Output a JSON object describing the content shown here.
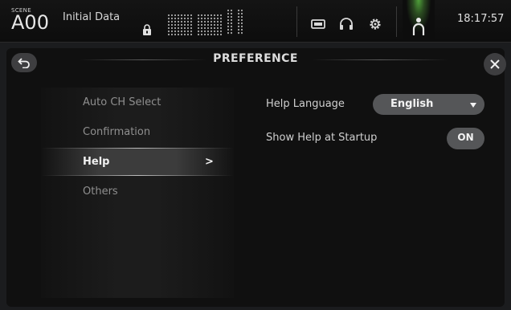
{
  "topbar": {
    "scene_small": "SCENE",
    "scene_number": "A00",
    "scene_title": "Initial Data",
    "clock": "18:17:57",
    "icons": [
      "lock-icon",
      "meters-icon",
      "recorder-icon",
      "headphones-icon",
      "gear-icon",
      "user-icon"
    ],
    "accent_color": "#4fa03a"
  },
  "panel": {
    "title": "PREFERENCE",
    "back_icon": "back-arrow-icon",
    "close_icon": "close-icon"
  },
  "menu": {
    "items": [
      {
        "label": "Auto CH Select",
        "selected": false
      },
      {
        "label": "Confirmation",
        "selected": false
      },
      {
        "label": "Help",
        "selected": true,
        "arrow": ">"
      },
      {
        "label": "Others",
        "selected": false
      }
    ]
  },
  "settings": {
    "help_language": {
      "label": "Help Language",
      "value": "English"
    },
    "show_help": {
      "label": "Show Help at Startup",
      "value": "ON"
    }
  }
}
